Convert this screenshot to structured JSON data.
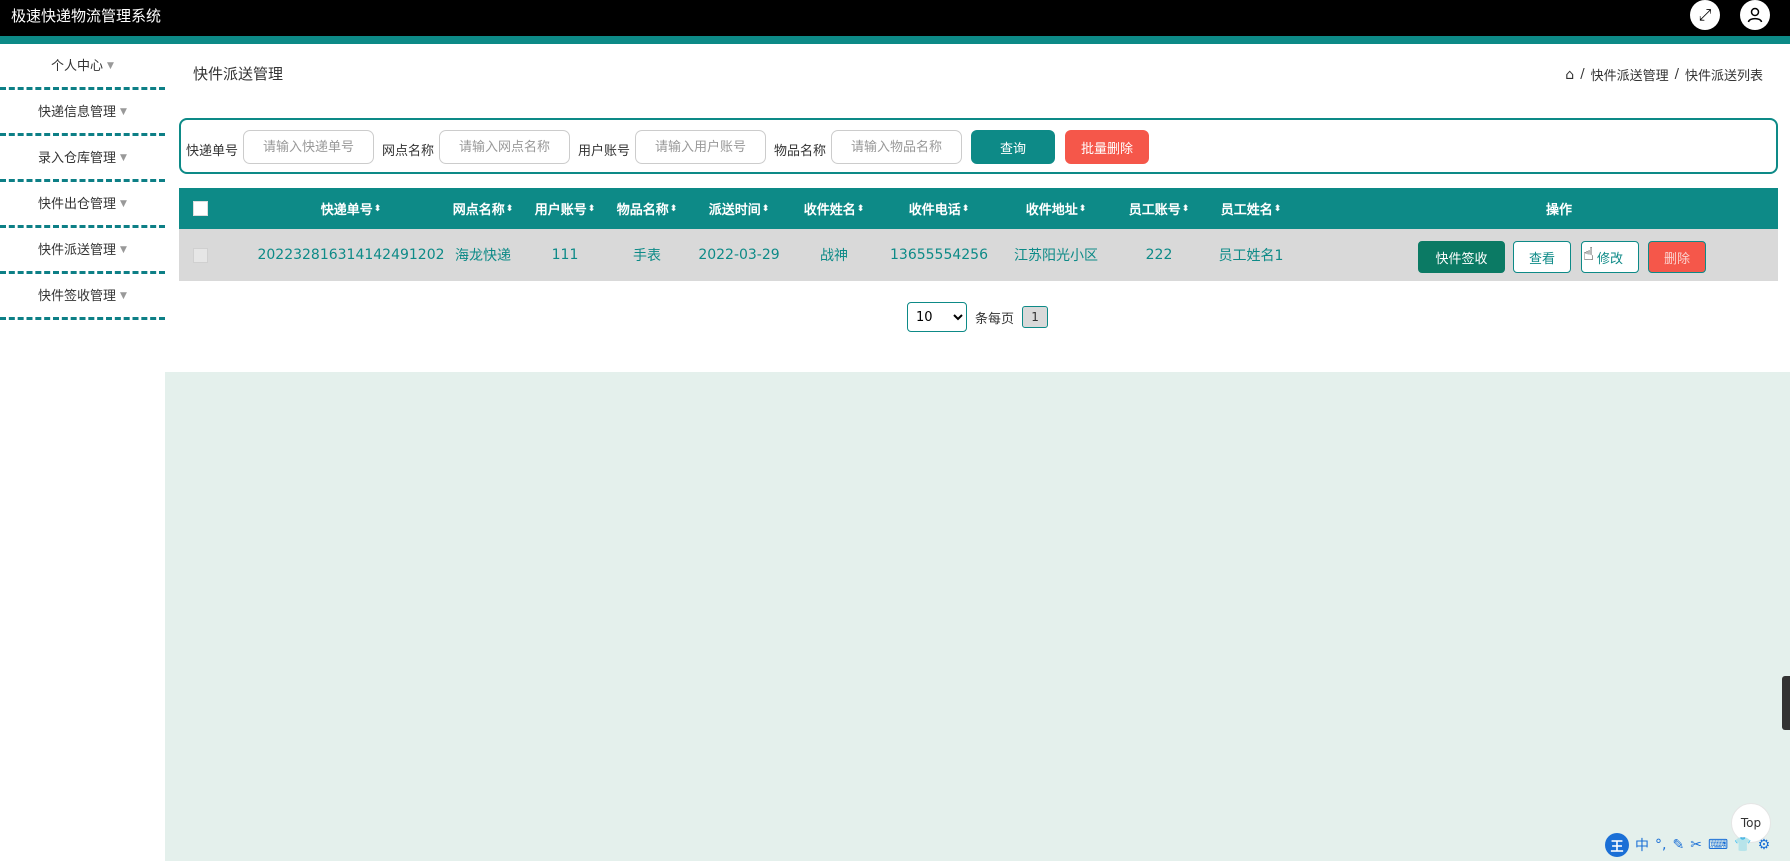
{
  "app": {
    "title": "极速快递物流管理系统"
  },
  "header": {
    "fullscreen_icon": "expand-icon",
    "user_icon": "user-icon"
  },
  "sidebar": {
    "items": [
      {
        "label": "个人中心"
      },
      {
        "label": "快递信息管理"
      },
      {
        "label": "录入仓库管理"
      },
      {
        "label": "快件出仓管理"
      },
      {
        "label": "快件派送管理"
      },
      {
        "label": "快件签收管理"
      }
    ]
  },
  "page": {
    "title": "快件派送管理",
    "breadcrumb": [
      "快件派送管理",
      "快件派送列表"
    ],
    "breadcrumb_sep": "/"
  },
  "search": {
    "fields": [
      {
        "label": "快递单号",
        "placeholder": "请输入快递单号",
        "value": ""
      },
      {
        "label": "网点名称",
        "placeholder": "请输入网点名称",
        "value": ""
      },
      {
        "label": "用户账号",
        "placeholder": "请输入用户账号",
        "value": ""
      },
      {
        "label": "物品名称",
        "placeholder": "请输入物品名称",
        "value": ""
      }
    ],
    "query_label": "查询",
    "batch_delete_label": "批量删除"
  },
  "table": {
    "headers": [
      "快递单号",
      "网点名称",
      "用户账号",
      "物品名称",
      "派送时间",
      "收件姓名",
      "收件电话",
      "收件地址",
      "员工账号",
      "员工姓名",
      "操作"
    ],
    "rows": [
      {
        "cells": [
          "20223281631414249120​2",
          "海龙快递",
          "111",
          "手表",
          "2022-03-29",
          "战神",
          "13655554256",
          "江苏阳光小区",
          "222",
          "员工姓名1"
        ],
        "actions": {
          "sign": "快件签收",
          "view": "查看",
          "edit": "修改",
          "delete": "删除"
        }
      }
    ]
  },
  "pagination": {
    "page_size": "10",
    "per_page_label": "条每页",
    "current_page": "1"
  },
  "footer": {
    "top_label": "Top",
    "ime": [
      "王",
      "中",
      "°,",
      "✎",
      "✂",
      "⌨",
      "👕",
      "⚙"
    ]
  },
  "colors": {
    "accent": "#0d8a87",
    "danger": "#f5574a",
    "background": "#e4f0ec"
  }
}
